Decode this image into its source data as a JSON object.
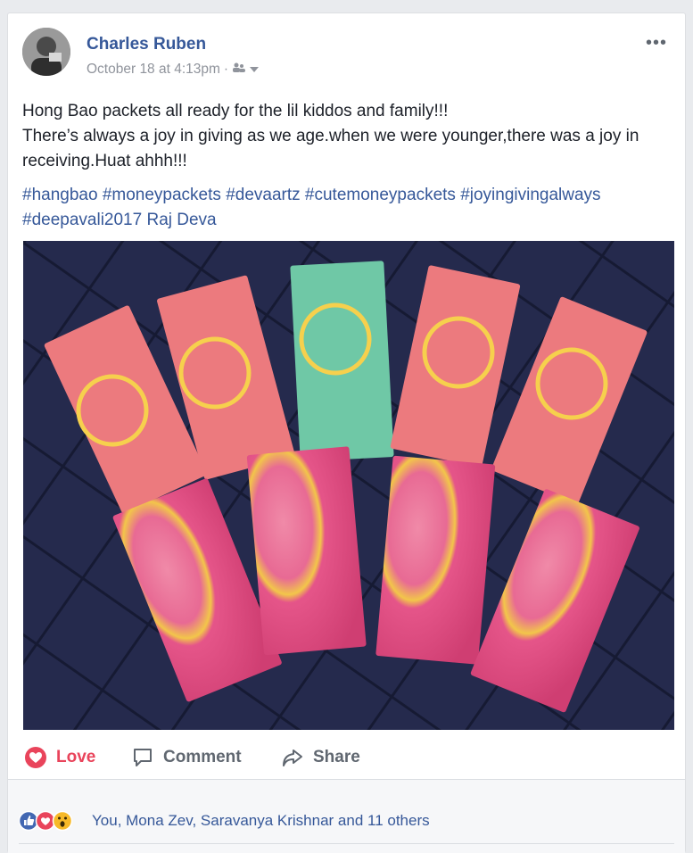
{
  "post": {
    "author": "Charles Ruben",
    "timestamp": "October 18 at 4:13pm",
    "separator": "·",
    "audience_icon": "friends-icon",
    "more_label": "•••",
    "text_line1": "Hong Bao packets all ready for the lil kiddos and family!!!",
    "text_line2": "There’s always a joy in giving as we age.when we were younger,there was a joy in receiving.Huat ahhh!!!",
    "hashtags": [
      "#hangbao",
      "#moneypackets",
      "#devaartz",
      "#cutemoneypackets",
      "#joyingivingalways",
      "#deepavali2017"
    ],
    "mention": "Raj Deva"
  },
  "actions": {
    "love": "Love",
    "comment": "Comment",
    "share": "Share"
  },
  "reactions": {
    "icons": [
      "like-icon",
      "love-icon",
      "wow-icon"
    ],
    "summary": "You, Mona Zev, Saravanya Krishnar and 11 others"
  },
  "colors": {
    "link": "#365899",
    "love": "#e9445b",
    "like": "#4267b2",
    "wow": "#f7b928",
    "muted": "#90949c"
  }
}
